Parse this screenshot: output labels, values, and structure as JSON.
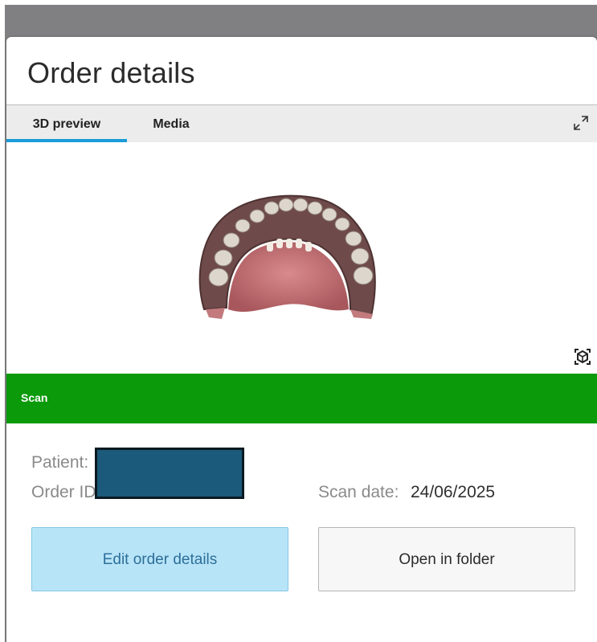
{
  "dialog": {
    "title": "Order details"
  },
  "tabs": [
    {
      "label": "3D preview",
      "active": true
    },
    {
      "label": "Media",
      "active": false
    }
  ],
  "icons": {
    "expand": "expand-arrows-icon",
    "view_cube": "view-cube-icon"
  },
  "scan_bar": {
    "label": "Scan",
    "color": "#0a9a0a"
  },
  "info": {
    "patient_label": "Patient:",
    "order_id_label": "Order ID:",
    "scan_date_label": "Scan date:",
    "scan_date_value": "24/06/2025"
  },
  "buttons": {
    "edit_label": "Edit order details",
    "open_label": "Open in folder"
  },
  "colors": {
    "accent": "#1a9bd7",
    "edit_button_bg": "#b8e4f8"
  }
}
